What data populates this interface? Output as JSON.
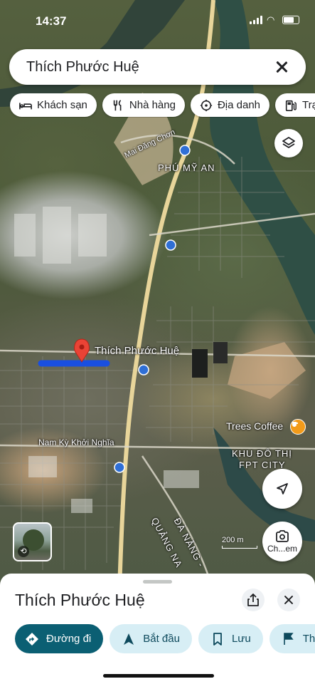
{
  "status": {
    "time": "14:37"
  },
  "search": {
    "query": "Thích Phước Huệ"
  },
  "chips": [
    {
      "label": "Khách sạn",
      "icon": "bed-icon"
    },
    {
      "label": "Nhà hàng",
      "icon": "restaurant-icon"
    },
    {
      "label": "Địa danh",
      "icon": "landmark-icon"
    },
    {
      "label": "Trạm xăng",
      "icon": "gas-station-icon"
    }
  ],
  "map": {
    "labels": {
      "street_mai_dang_chon": "Mai Đăng Chơn",
      "area_phu_my_an": "PHÚ MỸ AN",
      "street_nam_ky": "Nam Kỳ Khởi Nghĩa",
      "area_fpt_line1": "KHU ĐÔ THỊ",
      "area_fpt_line2": "FPT CITY",
      "road_quang_nam": "QUẢNG NA",
      "road_da_nang": "ĐÀ NẴNG -"
    },
    "selected_place": "Thích Phước Huệ",
    "poi_trees": "Trees Coffee",
    "scale_text": "200 m"
  },
  "lens_button": {
    "label": "Ch...em"
  },
  "sheet": {
    "title": "Thích Phước Huệ",
    "actions": [
      {
        "label": "Đường đi",
        "icon": "directions-icon"
      },
      {
        "label": "Bắt đầu",
        "icon": "navigate-icon"
      },
      {
        "label": "Lưu",
        "icon": "bookmark-icon"
      },
      {
        "label": "Thêm",
        "icon": "flag-icon"
      }
    ]
  },
  "colors": {
    "primary": "#0b5f73",
    "secondary_bg": "#d7eef5",
    "route_blue": "#1a4fe0",
    "pin_red": "#ea4335"
  }
}
